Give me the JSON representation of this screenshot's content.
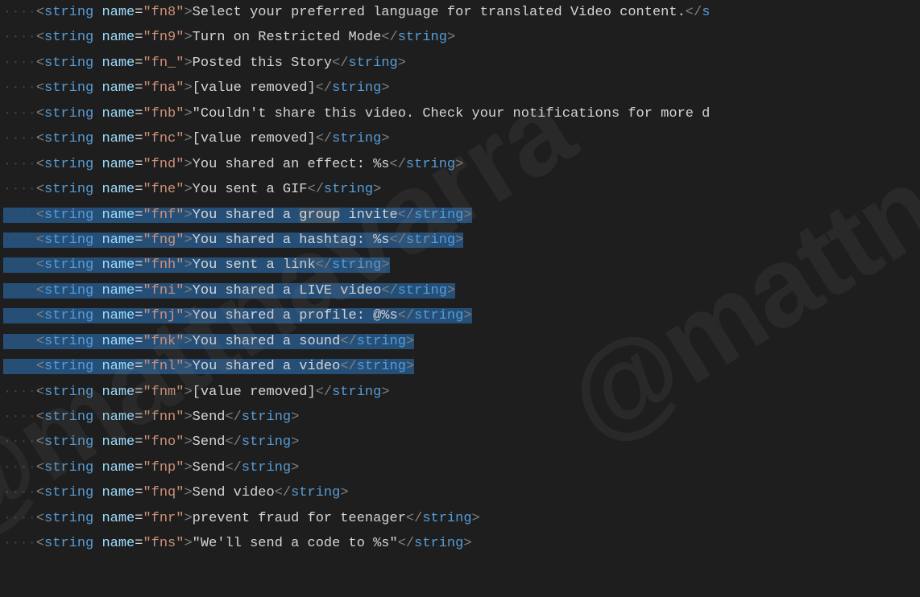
{
  "watermark": "@mattnavarra",
  "indent_dots": "····",
  "tag_name": "string",
  "attr_name": "name",
  "lines": [
    {
      "key": "fn8",
      "value": "Select your preferred language for translated Video content.",
      "selected": false,
      "truncated_close": true
    },
    {
      "key": "fn9",
      "value": "Turn on Restricted Mode",
      "selected": false
    },
    {
      "key": "fn_",
      "value": "Posted this Story",
      "selected": false
    },
    {
      "key": "fna",
      "value": "[value removed]",
      "selected": false
    },
    {
      "key": "fnb",
      "value": "\"Couldn't share this video. Check your notifications for more d",
      "selected": false,
      "no_close": true
    },
    {
      "key": "fnc",
      "value": "[value removed]",
      "selected": false
    },
    {
      "key": "fnd",
      "value": "You shared an effect: %s",
      "selected": false
    },
    {
      "key": "fne",
      "value": "You sent a GIF",
      "selected": false
    },
    {
      "key": "fnf",
      "value": "You shared a group invite",
      "selected": true,
      "highlight_word": "group"
    },
    {
      "key": "fng",
      "value": "You shared a hashtag: %s",
      "selected": true
    },
    {
      "key": "fnh",
      "value": "You sent a link",
      "selected": true
    },
    {
      "key": "fni",
      "value": "You shared a LIVE video",
      "selected": true
    },
    {
      "key": "fnj",
      "value": "You shared a profile: @%s",
      "selected": true
    },
    {
      "key": "fnk",
      "value": "You shared a sound",
      "selected": true
    },
    {
      "key": "fnl",
      "value": "You shared a video",
      "selected": true
    },
    {
      "key": "fnm",
      "value": "[value removed]",
      "selected": false
    },
    {
      "key": "fnn",
      "value": "Send",
      "selected": false
    },
    {
      "key": "fno",
      "value": "Send",
      "selected": false
    },
    {
      "key": "fnp",
      "value": "Send",
      "selected": false
    },
    {
      "key": "fnq",
      "value": "Send video",
      "selected": false
    },
    {
      "key": "fnr",
      "value": "prevent fraud for teenager",
      "selected": false
    },
    {
      "key": "fns",
      "value": "\"We'll send a code to %s\"",
      "selected": false
    }
  ]
}
